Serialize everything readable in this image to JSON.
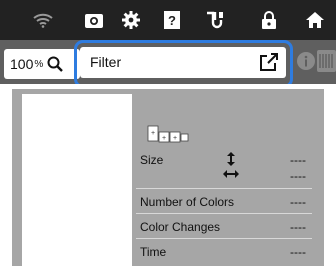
{
  "statusbar": {
    "icons": [
      "wifi-icon",
      "camera-icon",
      "settings-icon",
      "help-icon",
      "embroidery-arm-icon",
      "lock-icon",
      "home-icon"
    ]
  },
  "toolbar": {
    "zoom_value": "100",
    "zoom_unit": "%",
    "filter_label": "Filter"
  },
  "details": {
    "size_label": "Size",
    "size_height_value": "----",
    "size_width_value": "----",
    "colors_label": "Number of Colors",
    "colors_value": "----",
    "changes_label": "Color Changes",
    "changes_value": "----",
    "time_label": "Time",
    "time_value": "----"
  },
  "colors": {
    "statusbar_bg": "#222222",
    "toolbar_bg": "#5f5f5f",
    "highlight": "#2e7ce0",
    "panel_bg": "#a6a6a6"
  }
}
